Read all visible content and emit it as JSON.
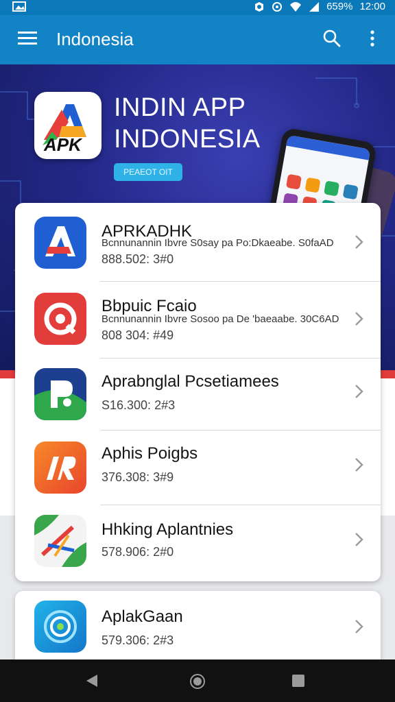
{
  "status_bar": {
    "left_icon": "gallery-icon",
    "battery": "659%",
    "time": "12:00"
  },
  "app_bar": {
    "title": "Indonesia",
    "menu_icon": "hamburger-menu-icon",
    "search_icon": "search-icon",
    "more_icon": "more-vert-icon"
  },
  "banner": {
    "logo_text": "APK",
    "title_line1": "INDIN APP",
    "title_line2": "INDONESIA",
    "button_label": "PEAEOT OIT"
  },
  "apps": [
    {
      "name": "APRKADHK",
      "subtitle": "Bcnnunannin Ibvre S0say pa Po:Dkaeabe. S0faAD",
      "meta": "888.502: 3#0",
      "icon": "apk-a-icon",
      "icon_color": "#1f5fd1"
    },
    {
      "name": "Bbpuic Fcaio",
      "subtitle": "Bcnnunannin Ibvre Sosoo pa De 'baeaabe. 30C6AD",
      "meta": "808 304: #49",
      "icon": "target-q-icon",
      "icon_color": "#e23d3a"
    },
    {
      "name": "Aprabnglal  Pcsetiamees",
      "subtitle": "",
      "meta": "S16.300: 2#3",
      "icon": "p-leaf-icon",
      "icon_color": "#2b8f3a"
    },
    {
      "name": "Aphis Poigbs",
      "subtitle": "",
      "meta": "376.308: 3#9",
      "icon": "ir-logo-icon",
      "icon_color": "#f0642a"
    },
    {
      "name": "Hhking Aplantnies",
      "subtitle": "",
      "meta": "578.906: 2#0",
      "icon": "tools-icon",
      "icon_color": "#3aa64b"
    },
    {
      "name": "AplakGaan",
      "subtitle": "",
      "meta": "579.306: 2#3",
      "icon": "swirl-icon",
      "icon_color": "#1a9ee0"
    }
  ],
  "nav_bar": {
    "back_icon": "back-triangle-icon",
    "home_icon": "home-circle-icon",
    "recent_icon": "recents-square-icon"
  }
}
